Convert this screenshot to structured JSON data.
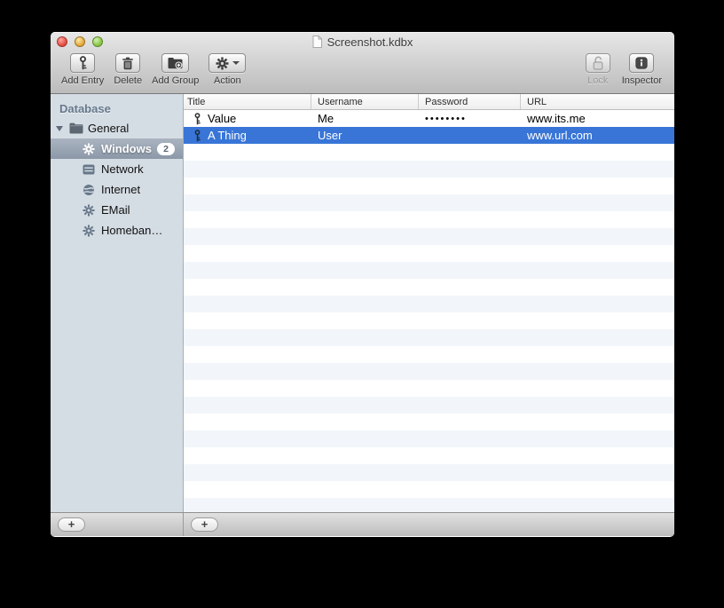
{
  "window": {
    "title": "Screenshot.kdbx"
  },
  "toolbar": {
    "buttons": [
      {
        "label": "Add Entry",
        "icon": "key-icon"
      },
      {
        "label": "Delete",
        "icon": "trash-icon"
      },
      {
        "label": "Add Group",
        "icon": "folder-plus-icon"
      },
      {
        "label": "Action",
        "icon": "gear-icon",
        "has_dropdown": true
      }
    ],
    "right_buttons": [
      {
        "label": "Lock",
        "icon": "lock-open-icon",
        "disabled": true
      },
      {
        "label": "Inspector",
        "icon": "info-icon"
      }
    ]
  },
  "sidebar": {
    "header": "Database",
    "group": {
      "label": "General",
      "expanded": true
    },
    "items": [
      {
        "label": "Windows",
        "icon": "gear-icon",
        "badge": "2",
        "selected": true
      },
      {
        "label": "Network",
        "icon": "window-icon"
      },
      {
        "label": "Internet",
        "icon": "globe-icon"
      },
      {
        "label": "EMail",
        "icon": "gear-icon"
      },
      {
        "label": "Homeban…",
        "icon": "gear-icon"
      }
    ],
    "add_button": "+"
  },
  "table": {
    "columns": [
      "Title",
      "Username",
      "Password",
      "URL"
    ],
    "rows": [
      {
        "title": "Value",
        "username": "Me",
        "password": "••••••••",
        "url": "www.its.me",
        "selected": false
      },
      {
        "title": "A Thing",
        "username": "User",
        "password": "",
        "url": "www.url.com",
        "selected": true
      }
    ],
    "add_button": "+"
  },
  "colors": {
    "selection_blue": "#3875d7",
    "row_stripe": "#f2f6fa",
    "sidebar_bg": "#d5dde4",
    "sidebar_selection_top": "#aab4c1",
    "sidebar_selection_bottom": "#8c98a8",
    "chrome_top": "#e7e7e7",
    "chrome_bottom": "#bcbcbc"
  }
}
